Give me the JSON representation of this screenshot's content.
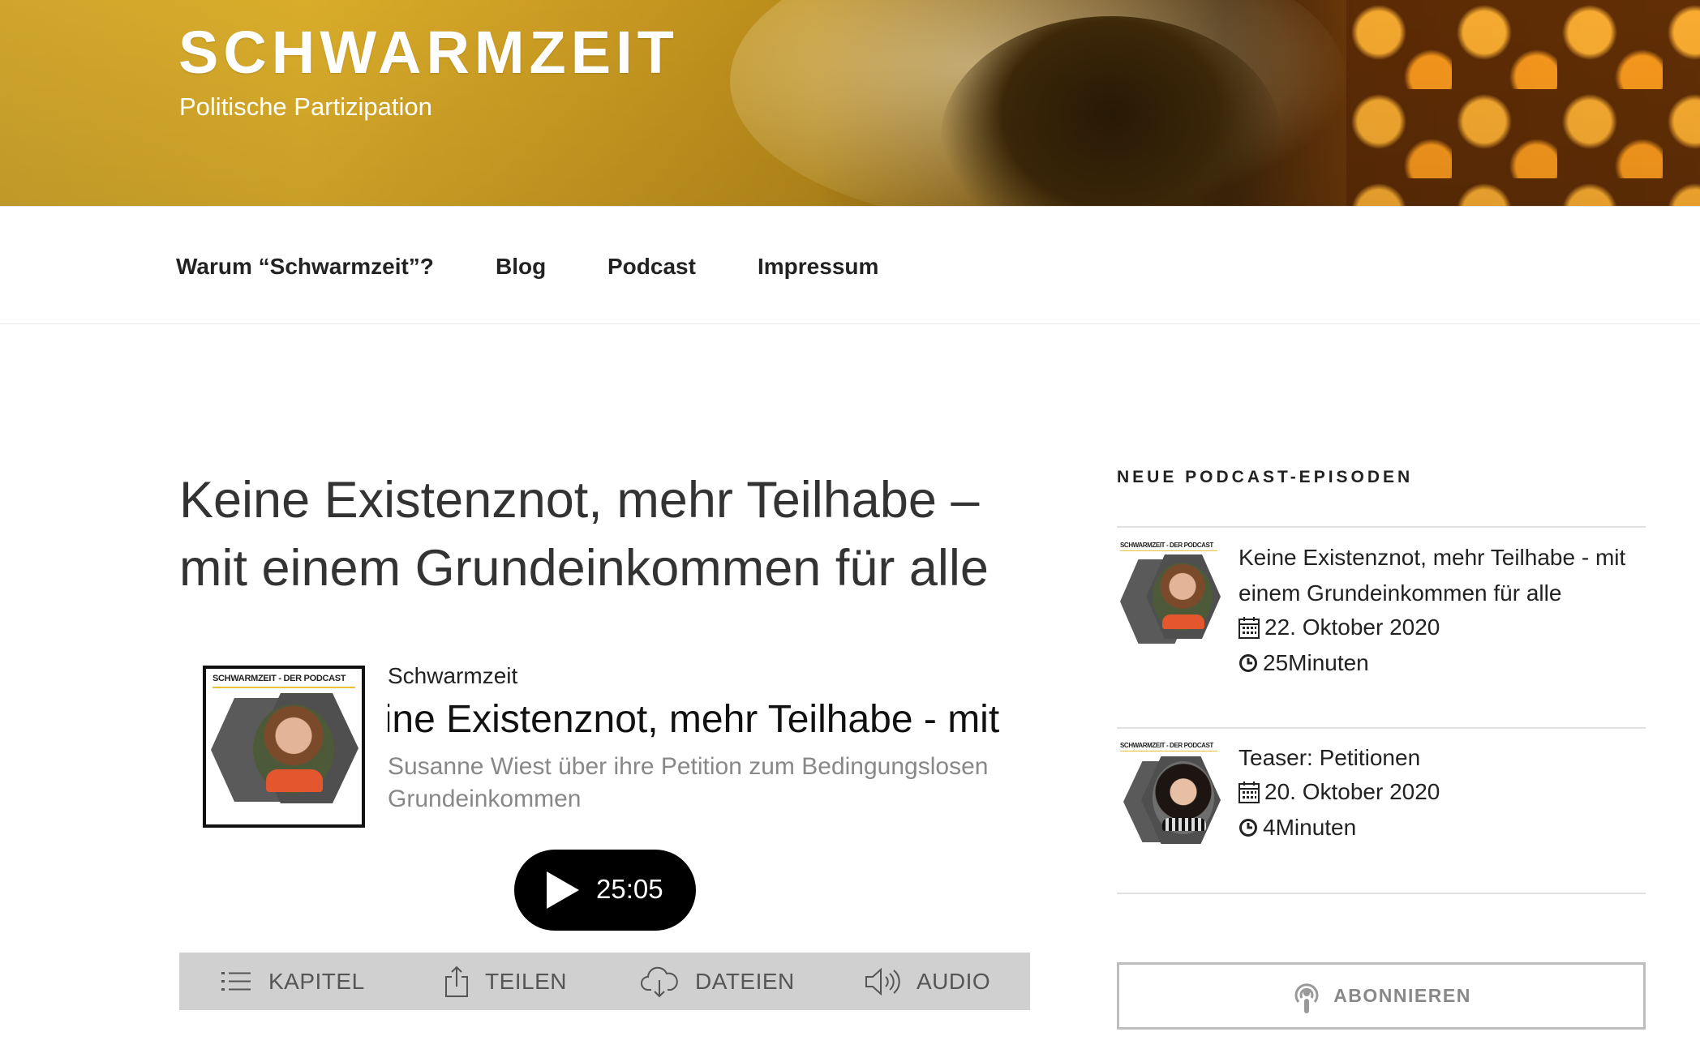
{
  "site": {
    "title": "SCHWARMZEIT",
    "tagline": "Politische Partizipation"
  },
  "nav": {
    "items": [
      {
        "label": "Warum “Schwarmzeit”?"
      },
      {
        "label": "Blog"
      },
      {
        "label": "Podcast"
      },
      {
        "label": "Impressum"
      }
    ]
  },
  "post": {
    "title": "Keine Existenznot, mehr Teilhabe – mit einem Grundeinkommen für alle"
  },
  "player": {
    "cover_label": "SCHWARMZEIT - DER PODCAST",
    "show": "Schwarmzeit",
    "episode_title": "Keine Existenznot, mehr Teilhabe - mit einem Grundeinkommen für alle",
    "subtitle": "Susanne Wiest über ihre Petition zum Bedingungslosen Grundeinkommen",
    "duration": "25:05",
    "tabs": [
      {
        "label": "KAPITEL",
        "icon": "list-icon"
      },
      {
        "label": "TEILEN",
        "icon": "share-icon"
      },
      {
        "label": "DATEIEN",
        "icon": "cloud-download-icon"
      },
      {
        "label": "AUDIO",
        "icon": "speaker-icon"
      }
    ]
  },
  "sidebar": {
    "widget_title": "NEUE PODCAST-EPISODEN",
    "thumb_label": "SCHWARMZEIT - DER PODCAST",
    "episodes": [
      {
        "title": "Keine Existenznot, mehr Teilhabe - mit einem Grundeinkommen für alle",
        "date": "22. Oktober 2020",
        "duration": "25Minuten"
      },
      {
        "title": "Teaser: Petitionen",
        "date": "20. Oktober 2020",
        "duration": "4Minuten"
      }
    ],
    "subscribe_label": "ABONNIEREN"
  },
  "colors": {
    "accent_gold": "#d9ac2a",
    "player_button": "#000000",
    "tabbar": "#d0d0d0"
  }
}
